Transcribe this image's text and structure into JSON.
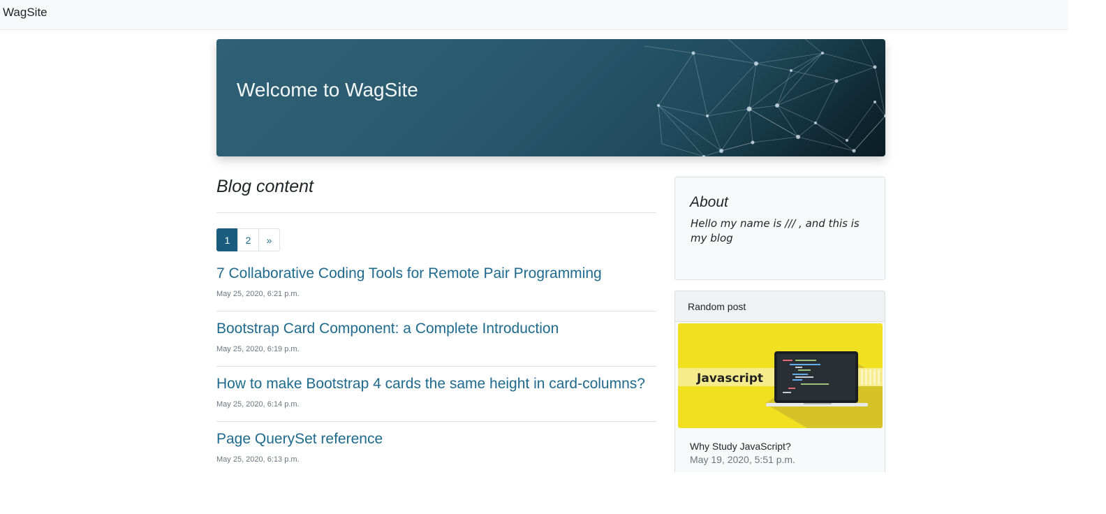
{
  "navbar": {
    "brand": "WagSite"
  },
  "hero": {
    "title": "Welcome to WagSite"
  },
  "blog": {
    "heading": "Blog content",
    "pagination": {
      "pages": [
        "1",
        "2"
      ],
      "next": "»",
      "active_page": 1
    },
    "posts": [
      {
        "title": "7 Collaborative Coding Tools for Remote Pair Programming",
        "date": "May 25, 2020, 6:21 p.m."
      },
      {
        "title": "Bootstrap Card Component: a Complete Introduction",
        "date": "May 25, 2020, 6:19 p.m."
      },
      {
        "title": "How to make Bootstrap 4 cards the same height in card-columns?",
        "date": "May 25, 2020, 6:14 p.m."
      },
      {
        "title": "Page QuerySet reference",
        "date": "May 25, 2020, 6:13 p.m."
      }
    ]
  },
  "sidebar": {
    "about": {
      "title": "About",
      "text": "Hello my name is /// , and this is my blog"
    },
    "random": {
      "header": "Random post",
      "image_label": "Javascript",
      "post_title": "Why Study JavaScript?",
      "post_date": "May 19, 2020, 5:51 p.m."
    }
  },
  "colors": {
    "link": "#1d6a8e",
    "page_active": "#195c7e",
    "hero_start": "#2f6075",
    "hero_end": "#0a1d25",
    "random_image_bg": "#f0e020"
  }
}
